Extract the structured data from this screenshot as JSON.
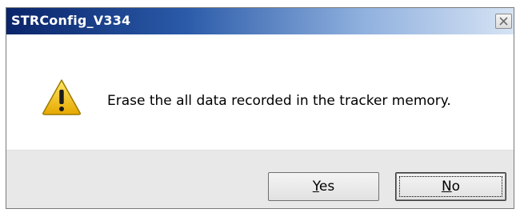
{
  "window": {
    "title": "STRConfig_V334",
    "close_icon": "close-icon"
  },
  "message": {
    "icon": "warning-icon",
    "text": "Erase the all data recorded in the tracker memory."
  },
  "buttons": {
    "yes": {
      "accel": "Y",
      "rest": "es"
    },
    "no": {
      "accel": "N",
      "rest": "o",
      "focused": true
    }
  },
  "colors": {
    "title_start": "#0a246a",
    "title_end": "#d6e3f4",
    "footer_bg": "#e8e8e8",
    "warning_yellow": "#f2c200"
  }
}
